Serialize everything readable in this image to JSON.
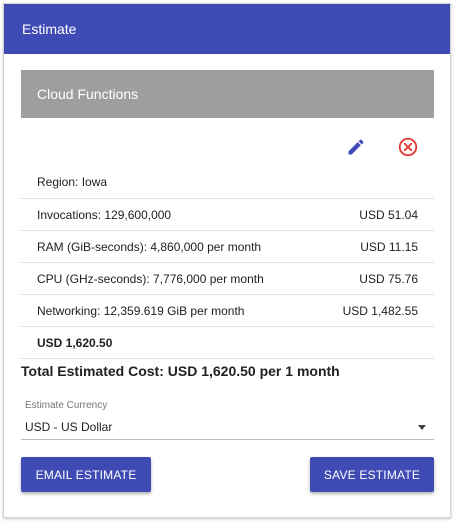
{
  "header": {
    "title": "Estimate"
  },
  "section": {
    "title": "Cloud Functions"
  },
  "icons": {
    "edit": "pencil-icon",
    "remove": "close-circle-icon"
  },
  "colors": {
    "primary": "#3f4bb5",
    "danger": "#e53935",
    "section_bg": "#9e9e9e"
  },
  "rows": [
    {
      "label": "Region: Iowa",
      "value": ""
    },
    {
      "label": "Invocations: 129,600,000",
      "value": "USD 51.04"
    },
    {
      "label": "RAM (GiB-seconds): 4,860,000 per month",
      "value": "USD 11.15"
    },
    {
      "label": "CPU (GHz-seconds): 7,776,000 per month",
      "value": "USD 75.76"
    },
    {
      "label": "Networking: 12,359.619 GiB per month",
      "value": "USD 1,482.55"
    },
    {
      "label": "USD 1,620.50",
      "value": ""
    }
  ],
  "total": {
    "text": "Total Estimated Cost: USD 1,620.50 per 1 month"
  },
  "currency": {
    "label": "Estimate Currency",
    "selected": "USD - US Dollar"
  },
  "buttons": {
    "email": "EMAIL ESTIMATE",
    "save": "SAVE ESTIMATE"
  }
}
